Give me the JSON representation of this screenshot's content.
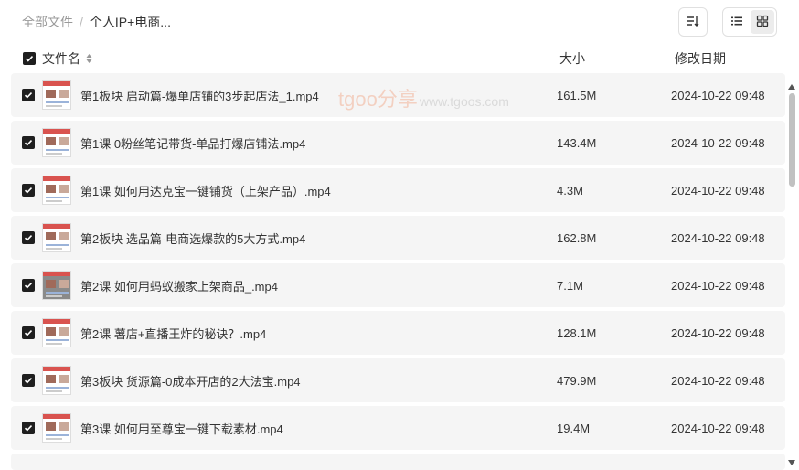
{
  "breadcrumb": {
    "root": "全部文件",
    "separator": "/",
    "current": "个人IP+电商..."
  },
  "toolbar": {
    "sort_icon": "sort-icon",
    "list_view_icon": "list-view-icon",
    "grid_view_icon": "grid-view-icon"
  },
  "table_header": {
    "name": "文件名",
    "size": "大小",
    "date": "修改日期"
  },
  "watermark": {
    "brand": "tgoo分享",
    "url": "www.tgoos.com"
  },
  "files": [
    {
      "name": "第1板块 启动篇-爆单店铺的3步起店法_1.mp4",
      "size": "161.5M",
      "date": "2024-10-22 09:48"
    },
    {
      "name": "第1课 0粉丝笔记带货-单品打爆店铺法.mp4",
      "size": "143.4M",
      "date": "2024-10-22 09:48"
    },
    {
      "name": "第1课 如何用达克宝一键铺货（上架产品）.mp4",
      "size": "4.3M",
      "date": "2024-10-22 09:48"
    },
    {
      "name": "第2板块 选品篇-电商选爆款的5大方式.mp4",
      "size": "162.8M",
      "date": "2024-10-22 09:48"
    },
    {
      "name": "第2课 如何用蚂蚁搬家上架商品_.mp4",
      "size": "7.1M",
      "date": "2024-10-22 09:48"
    },
    {
      "name": "第2课 薯店+直播王炸的秘诀？.mp4",
      "size": "128.1M",
      "date": "2024-10-22 09:48"
    },
    {
      "name": "第3板块 货源篇-0成本开店的2大法宝.mp4",
      "size": "479.9M",
      "date": "2024-10-22 09:48"
    },
    {
      "name": "第3课 如何用至尊宝一键下载素材.mp4",
      "size": "19.4M",
      "date": "2024-10-22 09:48"
    }
  ]
}
